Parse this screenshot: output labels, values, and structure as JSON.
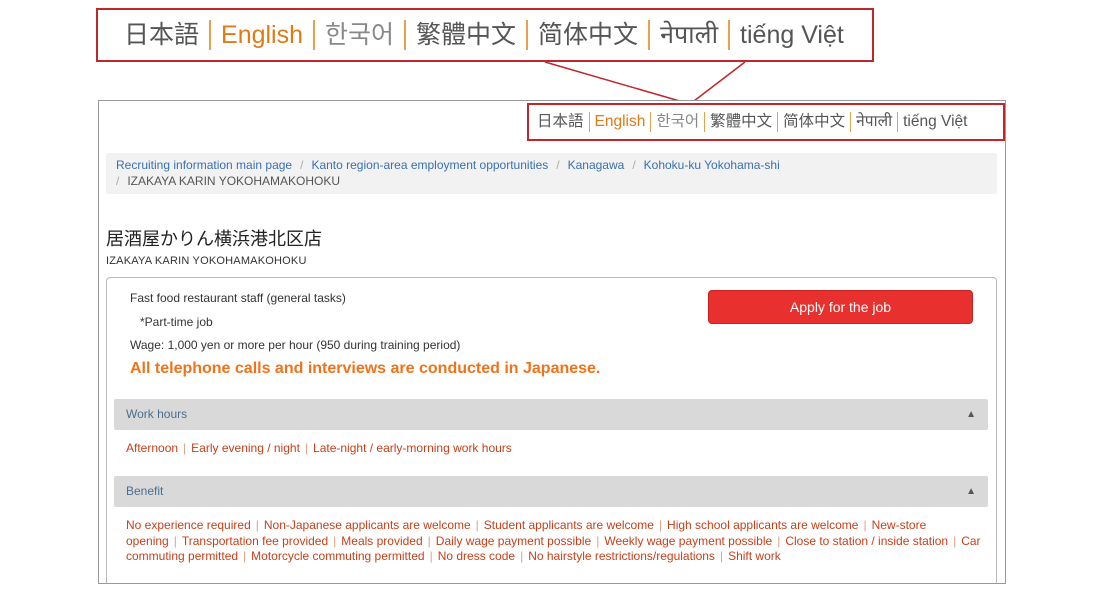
{
  "languages": [
    {
      "label": "日本語",
      "state": "normal"
    },
    {
      "label": "English",
      "state": "active"
    },
    {
      "label": "한국어",
      "state": "muted"
    },
    {
      "label": "繁體中文",
      "state": "normal"
    },
    {
      "label": "简体中文",
      "state": "normal"
    },
    {
      "label": "नेपाली",
      "state": "normal"
    },
    {
      "label": "tiếng Việt",
      "state": "normal"
    }
  ],
  "breadcrumb": {
    "items": [
      "Recruiting information main page",
      "Kanto region-area employment opportunities",
      "Kanagawa",
      "Kohoku-ku Yokohama-shi"
    ],
    "current": "IZAKAYA KARIN YOKOHAMAKOHOKU",
    "separator": "/"
  },
  "store": {
    "title": "居酒屋かりん横浜港北区店",
    "subtitle": "IZAKAYA KARIN YOKOHAMAKOHOKU"
  },
  "job": {
    "position": "Fast food restaurant staff (general tasks)",
    "type": "*Part-time job",
    "wage": "Wage: 1,000 yen or more per hour (950 during training period)",
    "notice": "All telephone calls and interviews are conducted in Japanese.",
    "apply_label": "Apply for the job"
  },
  "sections": {
    "work_hours": {
      "title": "Work hours",
      "tags": [
        "Afternoon",
        "Early evening / night",
        "Late-night / early-morning work hours"
      ]
    },
    "benefit": {
      "title": "Benefit",
      "tags": [
        "No experience required",
        "Non-Japanese applicants are welcome",
        "Student applicants are welcome",
        "High school applicants are welcome",
        "New-store opening",
        "Transportation fee provided",
        "Meals provided",
        "Daily wage payment possible",
        "Weekly wage payment possible",
        "Close to station / inside station",
        "Car commuting permitted",
        "Motorcycle commuting permitted",
        "No dress code",
        "No hairstyle restrictions/regulations",
        "Shift work"
      ]
    }
  },
  "icons": {
    "collapse": "chevron-up-icon"
  },
  "colors": {
    "accent_orange": "#e07a16",
    "highlight_red": "#c0272d",
    "apply_red": "#e8302e",
    "notice_orange": "#f0731c",
    "tag_red": "#c7401a",
    "link_blue": "#3a70b0"
  }
}
